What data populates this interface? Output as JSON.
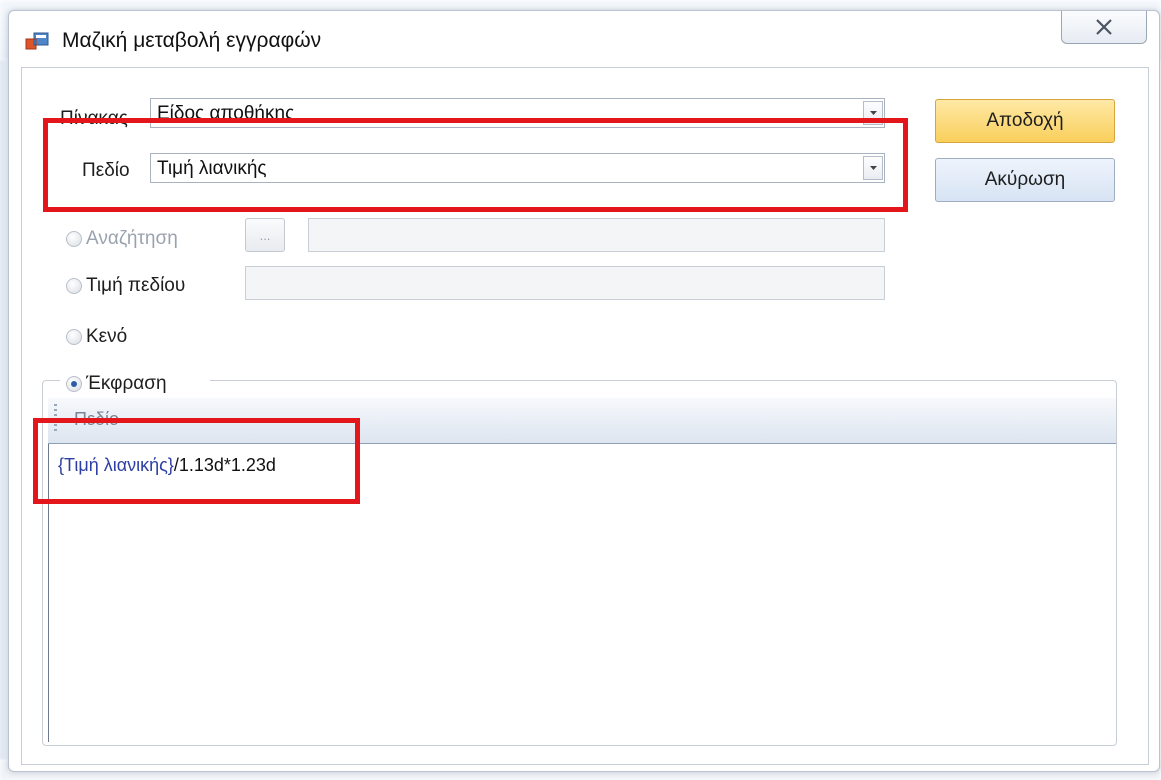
{
  "window": {
    "title": "Μαζική μεταβολή εγγραφών"
  },
  "form": {
    "table_label": "Πίνακας",
    "table_value": "Είδος αποθήκης",
    "field_label": "Πεδίο",
    "field_value": "Τιμή λιανικής"
  },
  "buttons": {
    "accept": "Αποδοχή",
    "cancel": "Ακύρωση",
    "browse": "..."
  },
  "options": {
    "search": "Αναζήτηση",
    "field_value": "Τιμή πεδίου",
    "empty": "Κενό",
    "expression": "Έκφραση",
    "selected": "expression"
  },
  "editor": {
    "field_menu": "Πεδίο",
    "expression_token": "{Τιμή λιανικής}",
    "expression_rest": "/1.13d*1.23d"
  },
  "colors": {
    "highlight": "#e3161c",
    "accept_button": "#f9cf5c",
    "expression_token": "#2b3fa6"
  }
}
